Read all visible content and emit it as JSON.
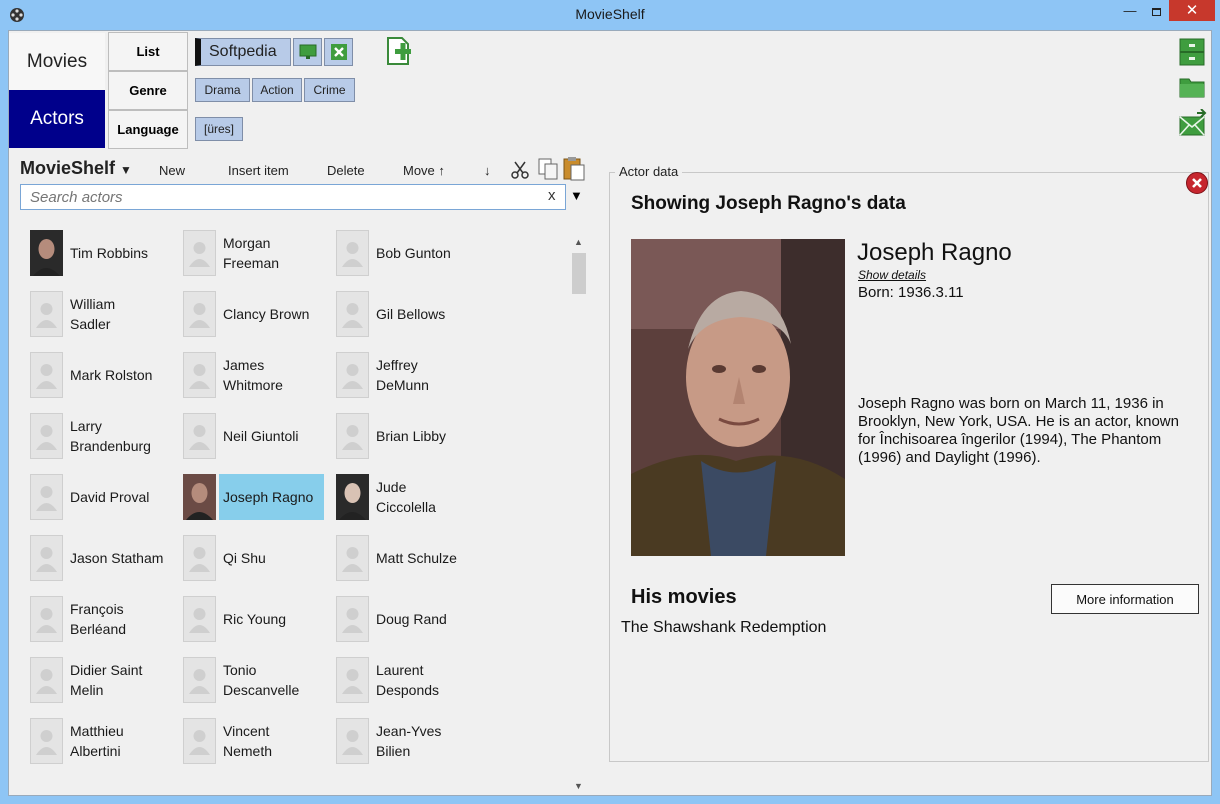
{
  "window": {
    "title": "MovieShelf"
  },
  "sidebar": {
    "tabs": [
      {
        "label": "Movies"
      },
      {
        "label": "Actors"
      }
    ],
    "subtabs": [
      {
        "label": "List"
      },
      {
        "label": "Genre"
      },
      {
        "label": "Language"
      }
    ]
  },
  "filters": {
    "source": "Softpedia",
    "genres": [
      "Drama",
      "Action",
      "Crime"
    ],
    "language": "[üres]"
  },
  "toolbar": {
    "collection": "MovieShelf",
    "new_label": "New",
    "insert_label": "Insert item",
    "delete_label": "Delete",
    "move_up_label": "Move ↑",
    "move_down_label": "↓"
  },
  "search": {
    "placeholder": "Search actors",
    "clear": "x"
  },
  "actors": [
    [
      {
        "line1": "Tim Robbins",
        "line2": ""
      },
      {
        "line1": "Morgan",
        "line2": "Freeman"
      },
      {
        "line1": "Bob Gunton",
        "line2": ""
      }
    ],
    [
      {
        "line1": "William",
        "line2": "Sadler"
      },
      {
        "line1": "Clancy Brown",
        "line2": ""
      },
      {
        "line1": "Gil Bellows",
        "line2": ""
      }
    ],
    [
      {
        "line1": "Mark Rolston",
        "line2": ""
      },
      {
        "line1": "James",
        "line2": "Whitmore"
      },
      {
        "line1": "Jeffrey",
        "line2": "DeMunn"
      }
    ],
    [
      {
        "line1": "Larry",
        "line2": "Brandenburg"
      },
      {
        "line1": "Neil Giuntoli",
        "line2": ""
      },
      {
        "line1": "Brian Libby",
        "line2": ""
      }
    ],
    [
      {
        "line1": "David Proval",
        "line2": ""
      },
      {
        "line1": "Joseph Ragno",
        "line2": ""
      },
      {
        "line1": "Jude",
        "line2": "Ciccolella"
      }
    ],
    [
      {
        "line1": "Jason Statham",
        "line2": ""
      },
      {
        "line1": "Qi Shu",
        "line2": ""
      },
      {
        "line1": "Matt Schulze",
        "line2": ""
      }
    ],
    [
      {
        "line1": "François",
        "line2": "Berléand"
      },
      {
        "line1": "Ric Young",
        "line2": ""
      },
      {
        "line1": "Doug Rand",
        "line2": ""
      }
    ],
    [
      {
        "line1": "Didier Saint",
        "line2": "Melin"
      },
      {
        "line1": "Tonio",
        "line2": "Descanvelle"
      },
      {
        "line1": "Laurent",
        "line2": "Desponds"
      }
    ],
    [
      {
        "line1": "Matthieu",
        "line2": "Albertini"
      },
      {
        "line1": "Vincent",
        "line2": "Nemeth"
      },
      {
        "line1": "Jean-Yves",
        "line2": "Bilien"
      }
    ]
  ],
  "selected_actor": "Joseph Ragno",
  "detail": {
    "group_label": "Actor data",
    "heading": "Showing Joseph Ragno's data",
    "name": "Joseph Ragno",
    "show_details": "Show details",
    "born": "Born: 1936.3.11",
    "bio": "Joseph Ragno was born on March 11, 1936 in Brooklyn, New York, USA. He is an actor, known for Închisoarea îngerilor (1994), The Phantom (1996) and Daylight (1996).",
    "movies_heading": "His movies",
    "more_info": "More information",
    "movies": [
      "The Shawshank Redemption"
    ]
  },
  "colors": {
    "selected_tab": "#00008b",
    "selected_row": "#87ceeb",
    "chip": "#b8cbe8",
    "titlebar": "#8ec5f5"
  }
}
